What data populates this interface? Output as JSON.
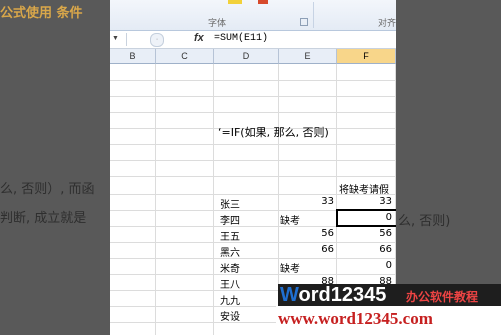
{
  "background_text": {
    "left_1": "公式使用 条件",
    "left_2": "么, 否则）, 而函",
    "left_3": "判断, 成立就是",
    "right_1": "么, 否则)"
  },
  "ribbon": {
    "font_group": "字体",
    "align_group": "对齐"
  },
  "formula_bar": {
    "fx_label": "fx",
    "formula": "=SUM(E11)"
  },
  "columns": [
    "B",
    "C",
    "D",
    "E",
    "F"
  ],
  "active_column": "F",
  "sheet": {
    "note": "‘=IF(如果, 那么, 否则)",
    "header_text": "将缺考请假",
    "rows": [
      {
        "name": "张三",
        "e": "33",
        "f": "33"
      },
      {
        "name": "李四",
        "e": "缺考",
        "f": "0"
      },
      {
        "name": "王五",
        "e": "56",
        "f": "56"
      },
      {
        "name": "黑六",
        "e": "66",
        "f": "66"
      },
      {
        "name": "米奇",
        "e": "缺考",
        "f": "0"
      },
      {
        "name": "王八",
        "e": "88",
        "f": "88"
      },
      {
        "name": "九九",
        "e": "",
        "f": ""
      },
      {
        "name": "安设",
        "e": "",
        "f": ""
      }
    ]
  },
  "watermark": {
    "brand_w": "W",
    "brand_ord": "ord",
    "brand_num": "12345",
    "brand_cn": "办公软件教程",
    "url": "www.word12345.com"
  }
}
